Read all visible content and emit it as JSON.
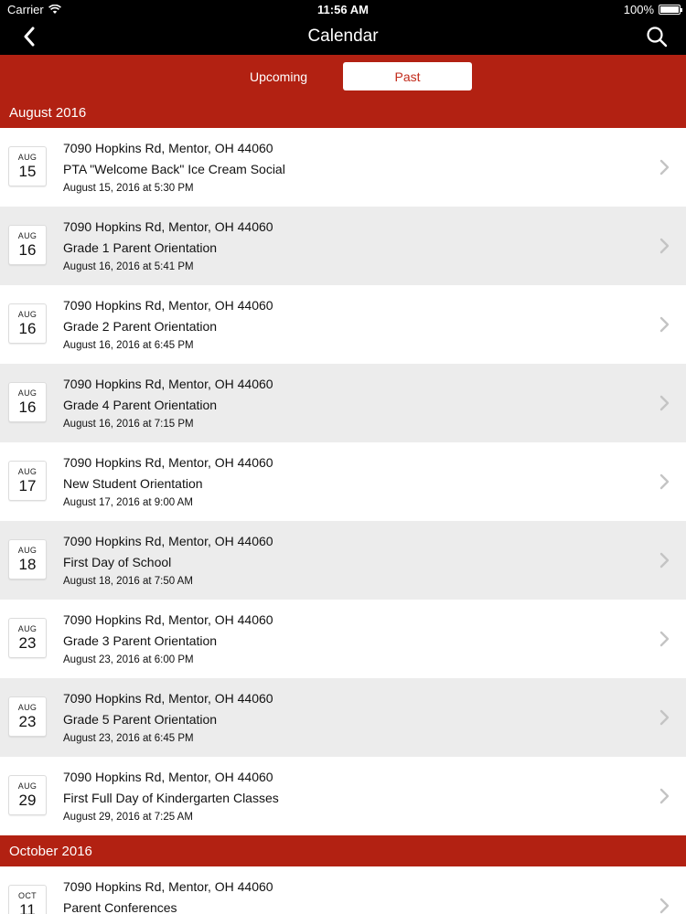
{
  "status_bar": {
    "carrier": "Carrier",
    "time": "11:56 AM",
    "battery": "100%",
    "battery_level": 1.0
  },
  "nav": {
    "title": "Calendar",
    "back_icon": "chevron-left-icon",
    "search_icon": "search-icon"
  },
  "segments": {
    "upcoming": "Upcoming",
    "past": "Past",
    "selected": "past"
  },
  "colors": {
    "accent": "#b22112",
    "selected_text": "#c22a1a",
    "alt_row": "#ececec"
  },
  "sections": [
    {
      "header": "August 2016",
      "events": [
        {
          "month": "AUG",
          "day": "15",
          "address": "7090 Hopkins Rd, Mentor, OH 44060",
          "title": "PTA \"Welcome Back\" Ice Cream Social",
          "when": "August 15, 2016 at 5:30 PM"
        },
        {
          "month": "AUG",
          "day": "16",
          "address": "7090 Hopkins Rd, Mentor, OH 44060",
          "title": "Grade 1 Parent Orientation",
          "when": "August 16, 2016 at 5:41 PM"
        },
        {
          "month": "AUG",
          "day": "16",
          "address": "7090 Hopkins Rd, Mentor, OH 44060",
          "title": "Grade 2 Parent Orientation",
          "when": "August 16, 2016 at 6:45 PM"
        },
        {
          "month": "AUG",
          "day": "16",
          "address": "7090 Hopkins Rd, Mentor, OH 44060",
          "title": "Grade 4 Parent Orientation",
          "when": "August 16, 2016 at 7:15 PM"
        },
        {
          "month": "AUG",
          "day": "17",
          "address": "7090 Hopkins Rd, Mentor, OH 44060",
          "title": "New Student Orientation",
          "when": "August 17, 2016 at 9:00 AM"
        },
        {
          "month": "AUG",
          "day": "18",
          "address": "7090 Hopkins Rd, Mentor, OH 44060",
          "title": "First Day of School",
          "when": "August 18, 2016 at 7:50 AM"
        },
        {
          "month": "AUG",
          "day": "23",
          "address": "7090 Hopkins Rd, Mentor, OH 44060",
          "title": "Grade 3 Parent Orientation",
          "when": "August 23, 2016 at 6:00 PM"
        },
        {
          "month": "AUG",
          "day": "23",
          "address": "7090 Hopkins Rd, Mentor, OH 44060",
          "title": "Grade 5 Parent Orientation",
          "when": "August 23, 2016 at 6:45 PM"
        },
        {
          "month": "AUG",
          "day": "29",
          "address": "7090 Hopkins Rd, Mentor, OH 44060",
          "title": "First Full Day of Kindergarten Classes",
          "when": "August 29, 2016 at 7:25 AM"
        }
      ]
    },
    {
      "header": "October 2016",
      "events": [
        {
          "month": "OCT",
          "day": "11",
          "address": "7090 Hopkins Rd, Mentor, OH 44060",
          "title": "Parent Conferences",
          "when": ""
        }
      ]
    }
  ]
}
